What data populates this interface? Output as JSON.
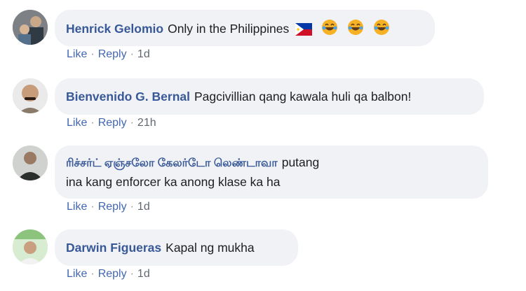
{
  "comments": [
    {
      "author": "Henrick Gelomio",
      "text": "Only in the Philippines",
      "flag_emoji": "🇵🇭",
      "emoji": "😂😂😂",
      "like_label": "Like",
      "reply_label": "Reply",
      "time": "1d",
      "avatar_icon": "avatar-photo"
    },
    {
      "author": "Bienvenido G. Bernal",
      "text": "Pagcivillian qang kawala huli qa balbon!",
      "like_label": "Like",
      "reply_label": "Reply",
      "time": "21h",
      "avatar_icon": "avatar-photo"
    },
    {
      "author": "ரிச்சர்ட் ஏஞ்சலோ கேலர்டோ லெண்டாவா",
      "text_line1": "putang",
      "text_line2": "ina kang enforcer ka anong klase ka ha",
      "like_label": "Like",
      "reply_label": "Reply",
      "time": "1d",
      "avatar_icon": "avatar-photo"
    },
    {
      "author": "Darwin Figueras",
      "text": "Kapal ng mukha",
      "like_label": "Like",
      "reply_label": "Reply",
      "time": "1d",
      "avatar_icon": "avatar-photo"
    }
  ],
  "separator": "·"
}
